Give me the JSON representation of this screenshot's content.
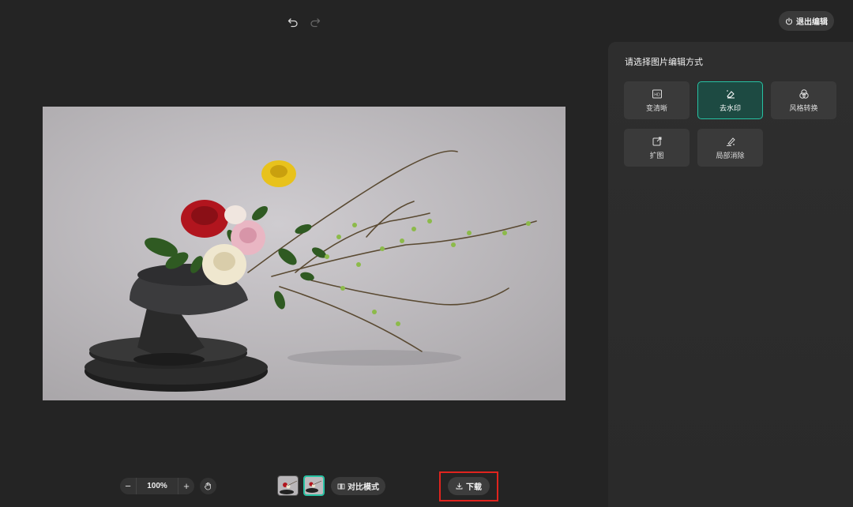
{
  "toolbar": {
    "undo_icon": "undo-icon",
    "redo_icon": "redo-icon",
    "exit_label": "退出编辑",
    "exit_icon": "power-icon"
  },
  "canvas": {
    "image_subject": "flower-arrangement-image"
  },
  "panel": {
    "title": "请选择图片编辑方式",
    "tools": [
      {
        "label": "变清晰",
        "icon": "hd-icon",
        "active": false
      },
      {
        "label": "去水印",
        "icon": "eraser-icon",
        "active": true
      },
      {
        "label": "风格转换",
        "icon": "style-circles-icon",
        "active": false
      },
      {
        "label": "扩图",
        "icon": "expand-image-icon",
        "active": false
      },
      {
        "label": "局部消除",
        "icon": "brush-erase-icon",
        "active": false
      }
    ]
  },
  "bottom": {
    "zoom_minus": "−",
    "zoom_value": "100%",
    "zoom_plus": "+",
    "hand_icon": "hand-icon",
    "compare_label": "对比模式",
    "compare_icon": "compare-icon",
    "download_label": "下载",
    "download_icon": "download-icon"
  },
  "colors": {
    "accent": "#27c2a3",
    "highlight_frame": "#e0241e",
    "background": "#242424"
  }
}
